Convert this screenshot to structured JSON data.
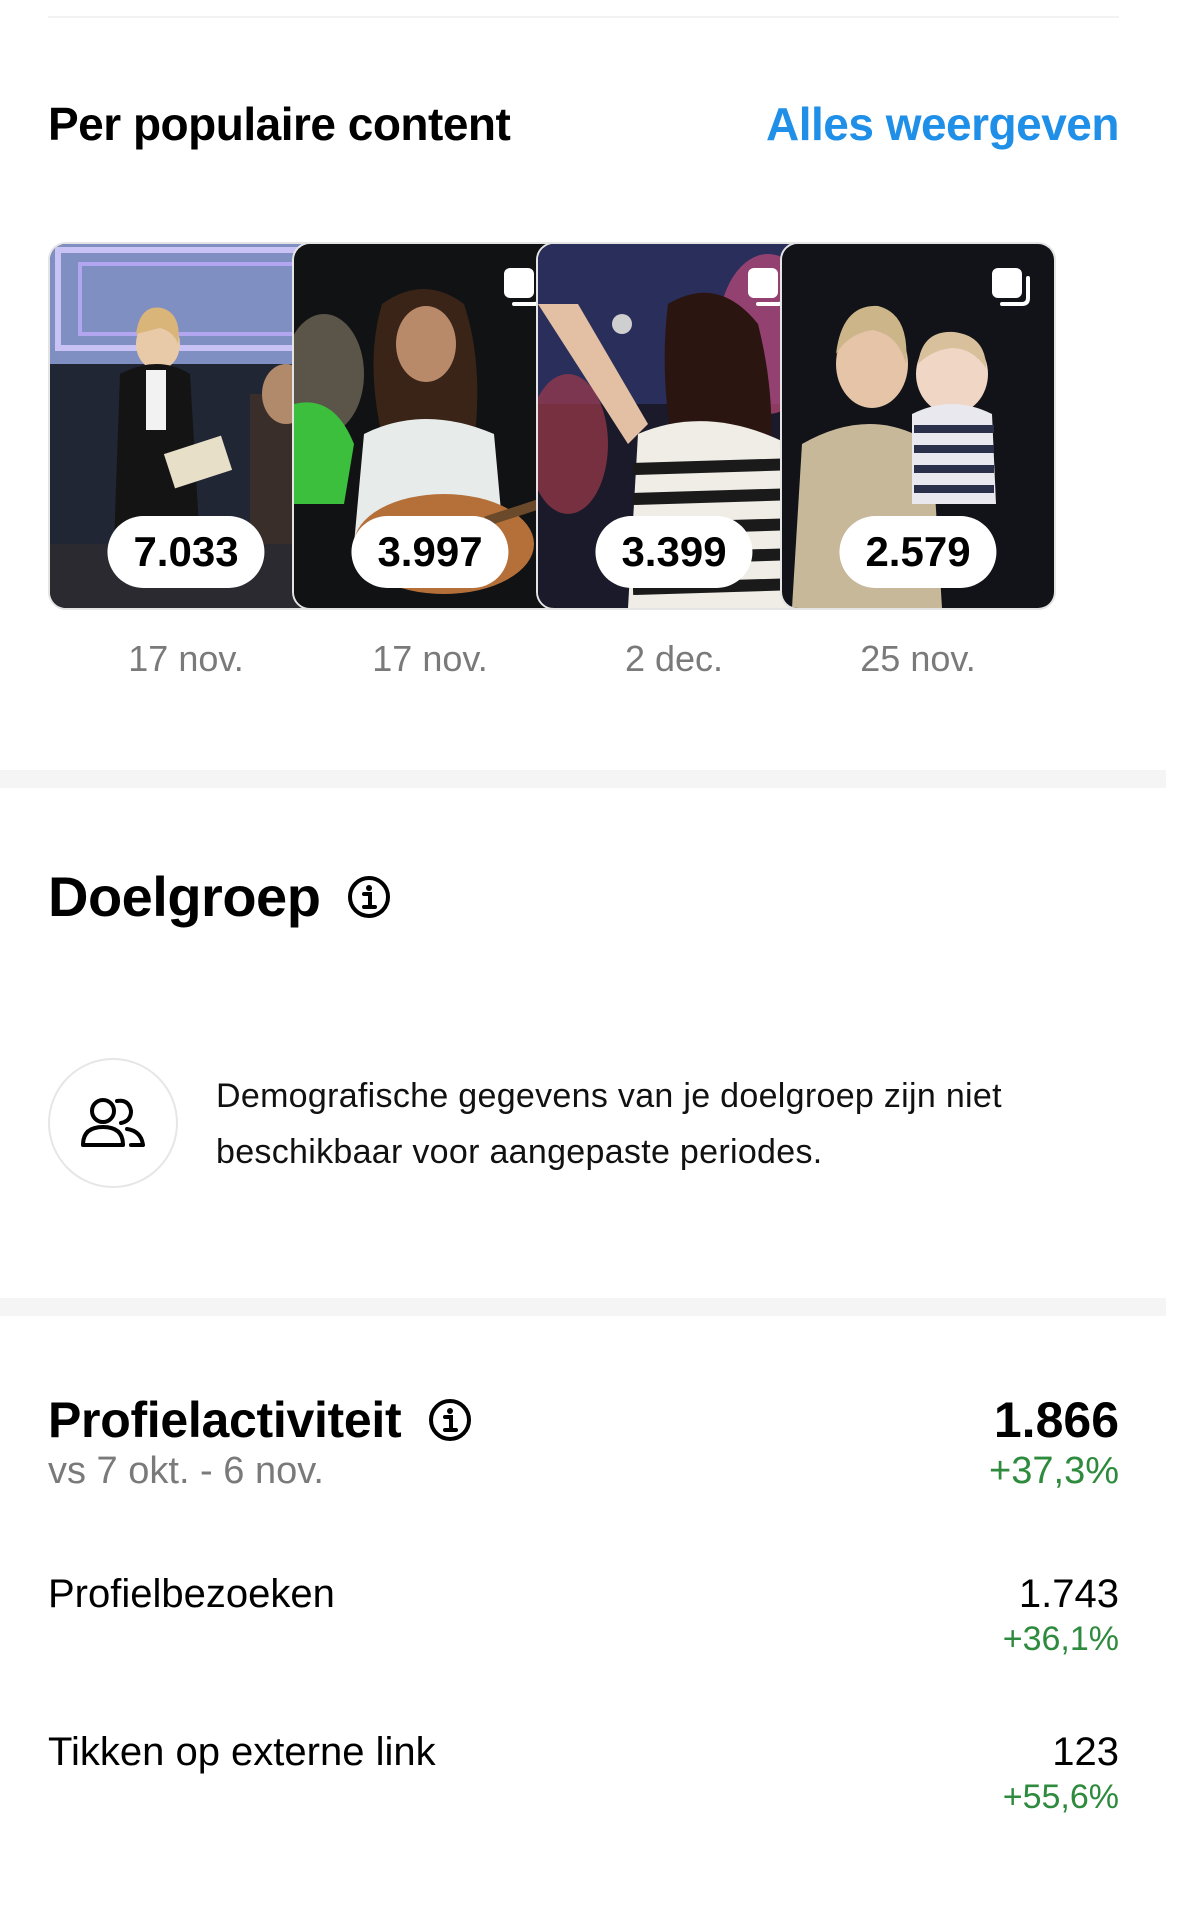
{
  "popular_content": {
    "title": "Per populaire content",
    "see_all": "Alles weergeven",
    "posts": [
      {
        "value": "7.033",
        "date": "17 nov."
      },
      {
        "value": "3.997",
        "date": "17 nov."
      },
      {
        "value": "3.399",
        "date": "2 dec."
      },
      {
        "value": "2.579",
        "date": "25 nov."
      }
    ]
  },
  "audience": {
    "title": "Doelgroep",
    "notice": "Demografische gegevens van je doelgroep zijn niet beschikbaar voor aangepaste periodes."
  },
  "profile_activity": {
    "title": "Profielactiviteit",
    "comparison": "vs 7 okt. - 6 nov.",
    "total": "1.866",
    "total_change": "+37,3%",
    "rows": [
      {
        "label": "Profielbezoeken",
        "value": "1.743",
        "change": "+36,1%"
      },
      {
        "label": "Tikken op externe link",
        "value": "123",
        "change": "+55,6%"
      }
    ]
  },
  "colors": {
    "link_blue": "#1f8fe8",
    "positive_green": "#2e8b3e"
  }
}
